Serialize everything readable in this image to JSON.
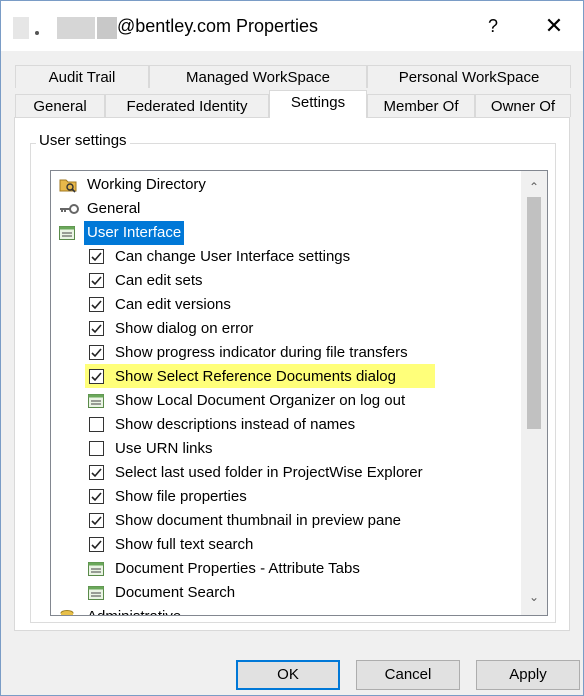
{
  "window": {
    "title": "@bentley.com Properties",
    "help_label": "?",
    "close_label": "✕"
  },
  "tabs_row1": [
    {
      "label": "Audit Trail"
    },
    {
      "label": "Managed WorkSpace"
    },
    {
      "label": "Personal WorkSpace"
    }
  ],
  "tabs_row2": [
    {
      "label": "General"
    },
    {
      "label": "Federated Identity"
    },
    {
      "label": "Settings",
      "selected": true
    },
    {
      "label": "Member Of"
    },
    {
      "label": "Owner Of"
    }
  ],
  "group": {
    "label": "User settings"
  },
  "tree": {
    "items": [
      {
        "label": "Working Directory",
        "kind": "folder-icon"
      },
      {
        "label": "General",
        "kind": "key-icon"
      },
      {
        "label": "User Interface",
        "kind": "list-icon",
        "selected": true
      },
      {
        "label": "Can change User Interface settings",
        "kind": "checkbox",
        "checked": true
      },
      {
        "label": "Can edit sets",
        "kind": "checkbox",
        "checked": true
      },
      {
        "label": "Can edit versions",
        "kind": "checkbox",
        "checked": true
      },
      {
        "label": "Show dialog on error",
        "kind": "checkbox",
        "checked": true
      },
      {
        "label": "Show progress indicator during file transfers",
        "kind": "checkbox",
        "checked": true
      },
      {
        "label": "Show Select Reference Documents dialog",
        "kind": "checkbox",
        "checked": true,
        "highlighted": true
      },
      {
        "label": "Show Local Document Organizer on log out",
        "kind": "list-icon"
      },
      {
        "label": "Show descriptions instead of names",
        "kind": "checkbox",
        "checked": false
      },
      {
        "label": "Use URN links",
        "kind": "checkbox",
        "checked": false
      },
      {
        "label": "Select last used folder in ProjectWise Explorer",
        "kind": "checkbox",
        "checked": true
      },
      {
        "label": "Show file properties",
        "kind": "checkbox",
        "checked": true
      },
      {
        "label": "Show document thumbnail in preview pane",
        "kind": "checkbox",
        "checked": true
      },
      {
        "label": "Show full text search",
        "kind": "checkbox",
        "checked": true
      },
      {
        "label": "Document Properties - Attribute Tabs",
        "kind": "list-icon"
      },
      {
        "label": "Document Search",
        "kind": "list-icon"
      },
      {
        "label": "Administrative",
        "kind": "db-icon"
      }
    ],
    "highlight_color": "#ffff7a",
    "selection_color": "#0078d7"
  },
  "buttons": {
    "ok": "OK",
    "cancel": "Cancel",
    "apply": "Apply"
  }
}
